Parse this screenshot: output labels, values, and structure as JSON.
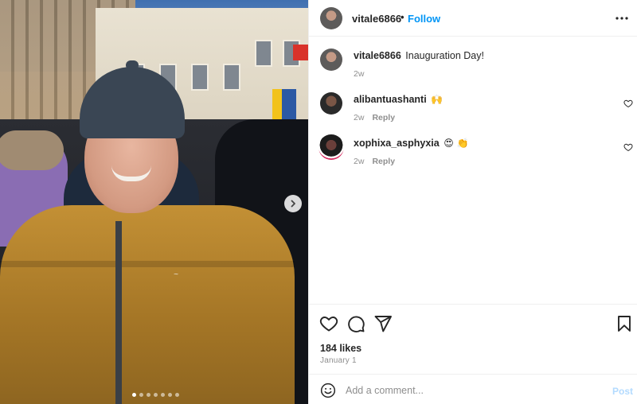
{
  "post": {
    "author": "vitale6866",
    "follow_label": "Follow",
    "separator": "•",
    "more_icon": "more-horizontal-icon",
    "carousel": {
      "slide_count": 7,
      "active_index": 0,
      "next_icon": "chevron-right-icon"
    }
  },
  "comments": [
    {
      "username": "vitale6866",
      "text": "Inauguration Day!",
      "time": "2w",
      "reply_label": ""
    },
    {
      "username": "alibantuashanti",
      "text": "🙌",
      "time": "2w",
      "reply_label": "Reply"
    },
    {
      "username": "xophixa_asphyxia",
      "text": "😍 👏",
      "time": "2w",
      "reply_label": "Reply"
    }
  ],
  "actions": {
    "like_icon": "heart-icon",
    "comment_icon": "comment-icon",
    "share_icon": "share-icon",
    "save_icon": "bookmark-icon",
    "likes_text": "184 likes",
    "date_text": "January 1"
  },
  "composer": {
    "placeholder": "Add a comment...",
    "post_label": "Post",
    "emoji_icon": "emoji-smile-icon"
  },
  "colors": {
    "link_blue": "#0095f6",
    "post_disabled": "#b3dbff",
    "muted": "#8e8e8e",
    "border": "#efefef"
  }
}
